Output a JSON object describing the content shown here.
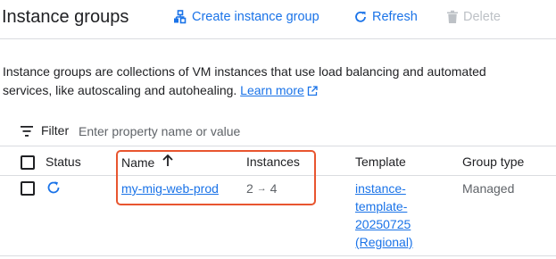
{
  "header": {
    "title": "Instance groups",
    "create_label": "Create instance group",
    "refresh_label": "Refresh",
    "delete_label": "Delete"
  },
  "description": {
    "text": "Instance groups are collections of VM instances that use load balancing and automated services, like autoscaling and autohealing.",
    "learn_more": "Learn more"
  },
  "filter": {
    "label": "Filter",
    "placeholder": "Enter property name or value"
  },
  "table": {
    "headers": {
      "status": "Status",
      "name": "Name",
      "instances": "Instances",
      "template": "Template",
      "group_type": "Group type"
    },
    "rows": [
      {
        "name": "my-mig-web-prod",
        "instances_from": "2",
        "instances_arrow": "→",
        "instances_to": "4",
        "template_lines": [
          "instance-",
          "template-",
          "20250725",
          "(Regional)"
        ],
        "group_type": "Managed"
      }
    ]
  },
  "colors": {
    "accent": "#1a73e8",
    "text": "#202124",
    "muted": "#5f6368",
    "disabled": "#bdc1c6",
    "highlight": "#e8552f",
    "divider": "#dadce0"
  }
}
